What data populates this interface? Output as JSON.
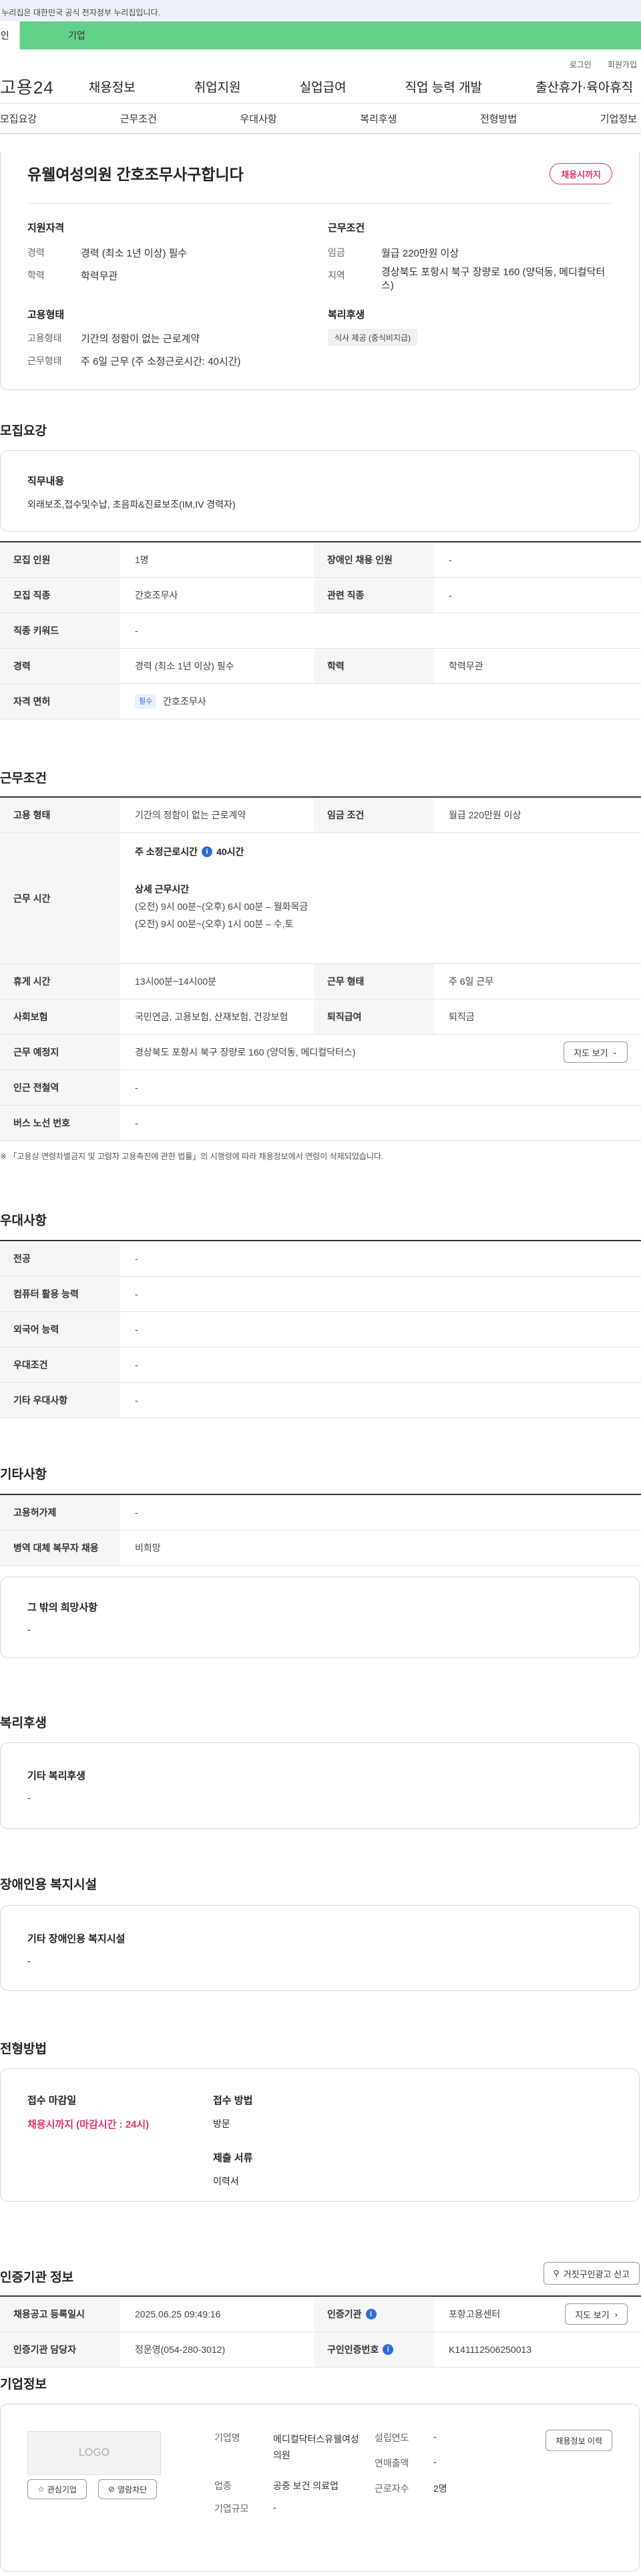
{
  "gov_notice": "이 누리집은 대한민국 공식 전자정부 누리집입니다.",
  "user_tabs": {
    "personal": "개인",
    "company": "기업"
  },
  "top_links": [
    "로그인",
    "회원가입"
  ],
  "logo": "고용24",
  "gnb": [
    "채용정보",
    "취업지원",
    "실업급여",
    "직업 능력 개발",
    "출산휴가·육아휴직"
  ],
  "subnav": [
    "모집요강",
    "근무조건",
    "우대사항",
    "복리후생",
    "전형방법",
    "기업정보"
  ],
  "header": {
    "title": "유웰여성의원 간호조무사구합니다",
    "deadline_badge": "채용시까지",
    "qualification_title": "지원자격",
    "qualification": [
      {
        "label": "경력",
        "value": "경력 (최소 1년 이상) 필수"
      },
      {
        "label": "학력",
        "value": "학력무관"
      }
    ],
    "work_title": "근무조건",
    "work": [
      {
        "label": "임금",
        "value": "월급 220만원 이상"
      },
      {
        "label": "지역",
        "value": "경상북도 포항시 북구 장량로 160 (양덕동, 메디컬닥터스)"
      }
    ],
    "employment_title": "고용형태",
    "employment": [
      {
        "label": "고용형태",
        "value": "기간의 정함이 없는 근로계약"
      },
      {
        "label": "근무형태",
        "value": "주 6일 근무 (주 소정근로시간: 40시간)"
      }
    ],
    "welfare_title": "복리후생",
    "welfare_tag": "식사 제공 (중식비지급)"
  },
  "recruit": {
    "section_title": "모집요강",
    "job_content_label": "직무내용",
    "job_content": "외래보조,접수및수납, 초음파&진료보조(IM,IV 경력자)",
    "rows": {
      "headcount_label": "모집 인원",
      "headcount": "1명",
      "disabled_label": "장애인 채용 인원",
      "disabled": "-",
      "job_label": "모집 직종",
      "job": "간호조무사",
      "related_label": "관련 직종",
      "related": "-",
      "keyword_label": "직종 키워드",
      "keyword": "-",
      "career_label": "경력",
      "career": "경력 (최소 1년 이상) 필수",
      "edu_label": "학력",
      "edu": "학력무관",
      "license_label": "자격 면허",
      "license_tag": "필수",
      "license": "간호조무사"
    }
  },
  "conditions": {
    "section_title": "근무조건",
    "type_label": "고용 형태",
    "type": "기간의 정함이 없는 근로계약",
    "wage_label": "임금 조건",
    "wage": "월급 220만원 이상",
    "hours_label": "근무 시간",
    "weekly_hours_label": "주 소정근로시간",
    "weekly_hours": "40시간",
    "detail_label": "상세 근무시간",
    "detail_1": "(오전) 9시 00분~(오후) 6시 00분 – 월화목금",
    "detail_2": "(오전) 9시 00분~(오후) 1시 00분 – 수,토",
    "break_label": "휴게 시간",
    "break": "13시00분~14시00분",
    "shift_label": "근무 형태",
    "shift": "주 6일 근무",
    "insurance_label": "사회보험",
    "insurance": "국민연금, 고용보험, 산재보험, 건강보험",
    "severance_label": "퇴직급여",
    "severance": "퇴직금",
    "location_label": "근무 예정지",
    "location": "경상북도 포항시 북구 장량로 160 (양덕동, 메디컬닥터스)",
    "map_button": "지도 보기",
    "subway_label": "인근 전철역",
    "subway": "-",
    "bus_label": "버스 노선 번호",
    "bus": "-",
    "footnote": "「고용상 연령차별금지 및 고령자 고용촉진에 관한 법률」의 시행령에 따라 채용정보에서 연령이 삭제되었습니다."
  },
  "preference": {
    "section_title": "우대사항",
    "rows": [
      {
        "label": "전공",
        "value": "-"
      },
      {
        "label": "컴퓨터 활용 능력",
        "value": "-"
      },
      {
        "label": "외국어 능력",
        "value": "-"
      },
      {
        "label": "우대조건",
        "value": "-"
      },
      {
        "label": "기타 우대사항",
        "value": "-"
      }
    ]
  },
  "etc": {
    "section_title": "기타사항",
    "rows": [
      {
        "label": "고용허가제",
        "value": "-"
      },
      {
        "label": "병역 대체 복무자 채용",
        "value": "비희망"
      }
    ],
    "other_label": "그 밖의 희망사항",
    "other": "-"
  },
  "welfare": {
    "section_title": "복리후생",
    "label": "기타 복리후생",
    "value": "-"
  },
  "disability": {
    "section_title": "장애인용 복지시설",
    "label": "기타 장애인용 복지시설",
    "value": "-"
  },
  "selection": {
    "section_title": "전형방법",
    "deadline_label": "접수 마감일",
    "deadline": "채용시까지 (마감시간 : 24시)",
    "method_label": "접수 방법",
    "method": "방문",
    "docs_label": "제출 서류",
    "docs": "이력서"
  },
  "agency": {
    "section_title": "인증기관 정보",
    "report_button": "거짓구인광고 신고",
    "reg_date_label": "채용공고 등록일시",
    "reg_date": "2025.06.25 09:49:16",
    "agency_label": "인증기관",
    "agency": "포항고용센터",
    "map_button": "지도 보기",
    "manager_label": "인증기관 담당자",
    "manager": "정운영(054-280-3012)",
    "cert_label": "구인인증번호",
    "cert": "K141112506250013"
  },
  "company": {
    "section_title": "기업정보",
    "logo_text": "LOGO",
    "fav_button": "관심기업",
    "hide_button": "열람차단",
    "name_label": "기업명",
    "name": "메디컬닥터스유웰여성의원",
    "industry_label": "업종",
    "industry": "공중 보건 의료업",
    "size_label": "기업규모",
    "size": "-",
    "founded_label": "설립연도",
    "founded": "-",
    "revenue_label": "연매출액",
    "revenue": "-",
    "employees_label": "근로자수",
    "employees": "2명",
    "history_button": "채용정보 이력"
  }
}
